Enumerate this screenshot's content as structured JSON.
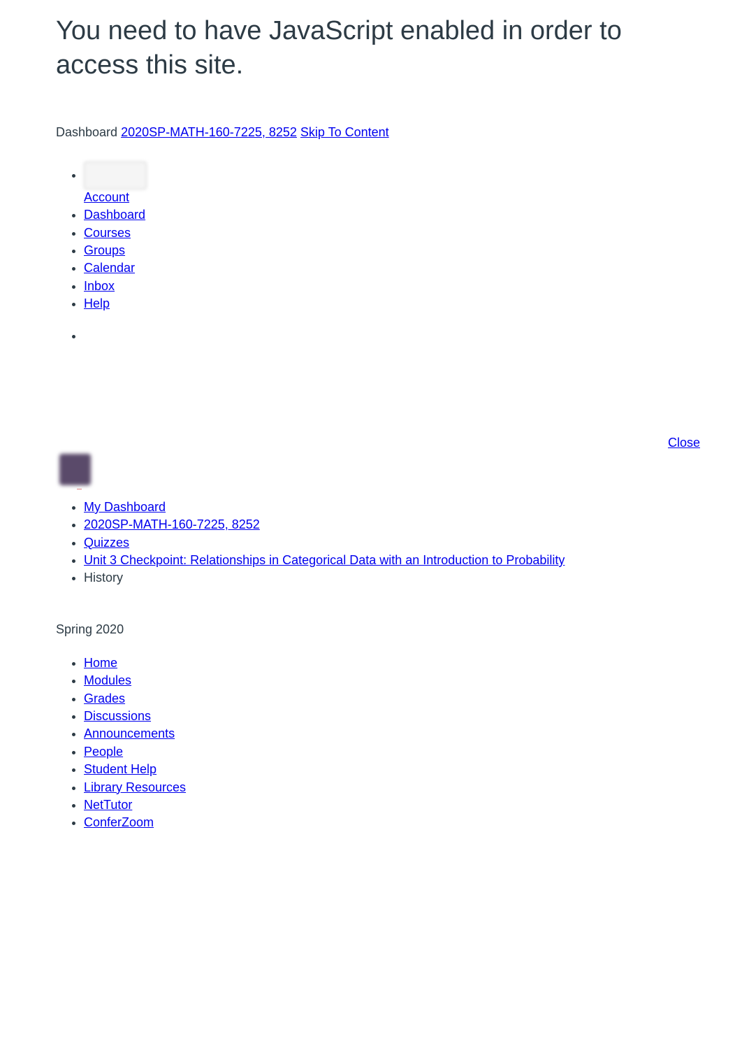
{
  "page_title": "You need to have JavaScript enabled in order to access this site.",
  "breadcrumb": {
    "dashboard": "Dashboard",
    "course": "2020SP-MATH-160-7225, 8252",
    "skip": "Skip To Content"
  },
  "global_nav": {
    "account": "Account",
    "dashboard": "Dashboard",
    "courses": "Courses",
    "groups": "Groups",
    "calendar": "Calendar",
    "inbox": "Inbox",
    "help": "Help"
  },
  "close_label": "Close",
  "avatar_label": "—",
  "crumbs": {
    "my_dashboard": "My Dashboard",
    "course": "2020SP-MATH-160-7225, 8252",
    "quizzes": "Quizzes",
    "quiz_title": "Unit 3 Checkpoint: Relationships in Categorical Data with an Introduction to Probability",
    "history": "History"
  },
  "term": "Spring 2020",
  "course_nav": {
    "home": "Home",
    "modules": "Modules",
    "grades": "Grades",
    "discussions": "Discussions",
    "announcements": "Announcements",
    "people": "People",
    "student_help": "Student Help",
    "library_resources": "Library Resources",
    "nettutor": "NetTutor",
    "conferzoom": "ConferZoom"
  }
}
